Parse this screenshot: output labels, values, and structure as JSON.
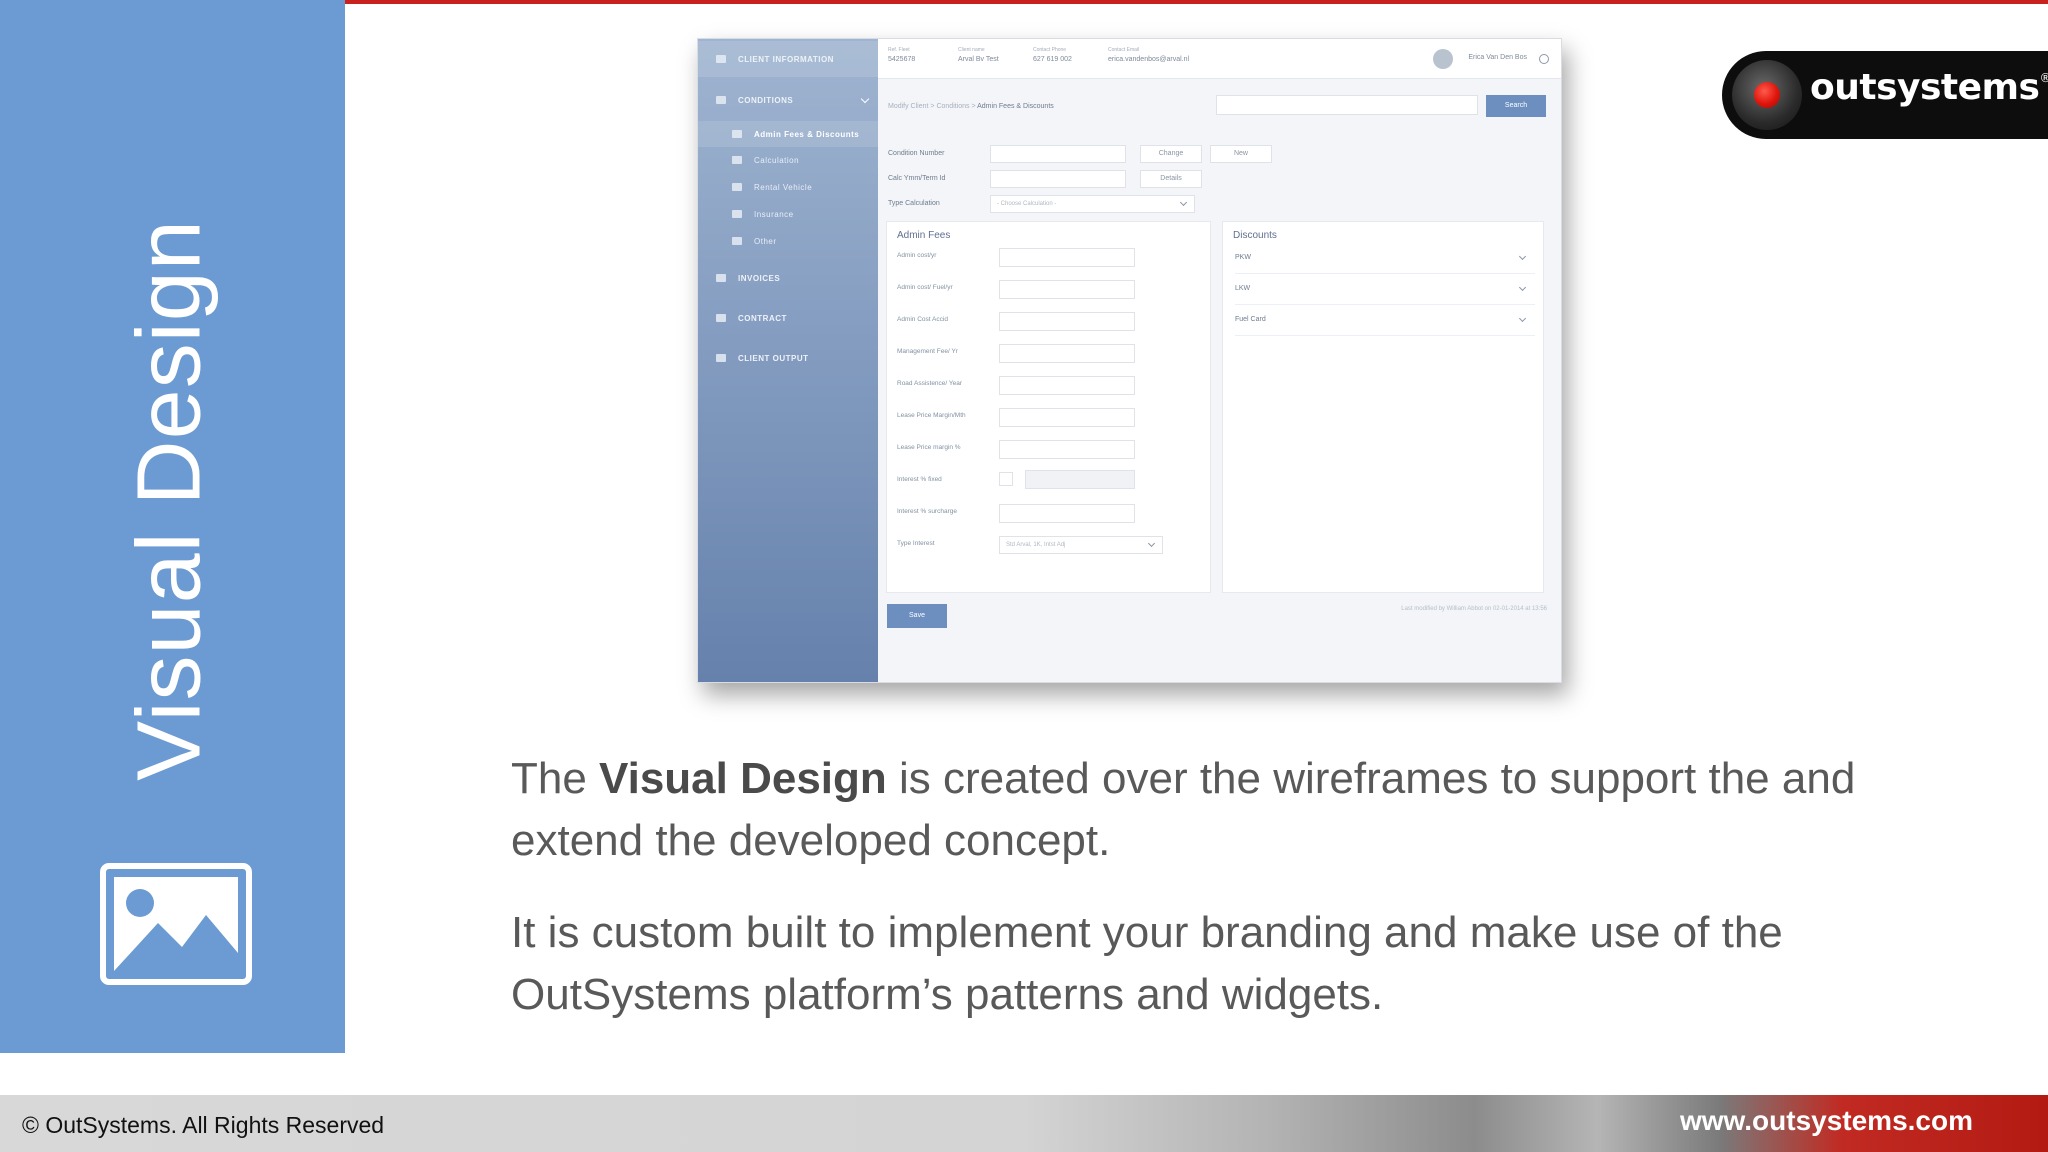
{
  "slide": {
    "vertical_title": "Visual Design",
    "paragraph1_pre": "The ",
    "paragraph1_bold": "Visual Design",
    "paragraph1_post": " is created over the wireframes to support the and extend the developed concept.",
    "paragraph2": "It is custom built to implement your branding and make use of the OutSystems platform’s patterns and widgets.",
    "icon": "picture-icon",
    "accent_color": "#c9211e",
    "panel_color": "#6b9bd2"
  },
  "logo": {
    "text": "outsystems",
    "mark": "®"
  },
  "footer": {
    "copyright": "© OutSystems. All Rights Reserved",
    "website": "www.outsystems.com"
  },
  "screenshot": {
    "sidebar": {
      "client_information": "CLIENT INFORMATION",
      "conditions": "CONDITIONS",
      "admin_fees": "Admin Fees & Discounts",
      "calculation": "Calculation",
      "rental_vehicle": "Rental Vehicle",
      "insurance": "Insurance",
      "other": "Other",
      "invoices": "INVOICES",
      "contract": "CONTRACT",
      "client_output": "CLIENT OUTPUT"
    },
    "topbar": {
      "f1_label": "Ref. Fleet",
      "f1_value": "5425678",
      "f2_label": "Client name",
      "f2_value": "Arval Bv Test",
      "f3_label": "Contact Phone",
      "f3_value": "627 619 002",
      "f4_label": "Contact Email",
      "f4_value": "erica.vandenbos@arval.nl",
      "user": "Erica Van Den Bos"
    },
    "breadcrumb": {
      "c1": "Modify Client",
      "c2": "Conditions",
      "c3": "Admin Fees & Discounts"
    },
    "search_label": "Search",
    "form": {
      "condition_number": "Condition Number",
      "change": "Change",
      "new": "New",
      "calc_term": "Calc Ymm/Term Id",
      "details": "Details",
      "type_calculation": "Type Calculation",
      "type_calculation_value": "- Choose Calculation -"
    },
    "admin_fees": {
      "title": "Admin Fees",
      "labels": [
        "Admin cost/yr",
        "Admin cost/ Fuel/yr",
        "Admin Cost Accid",
        "Management Fee/ Yr",
        "Road Assistence/ Year",
        "Lease Price Margin/Mth",
        "Lease Price margin %",
        "Interest % fixed",
        "Interest % surcharge",
        "Type Interest"
      ],
      "type_interest_value": "Std Arval, 1K, Intst Adj"
    },
    "discounts": {
      "title": "Discounts",
      "items": [
        "PKW",
        "LKW",
        "Fuel Card"
      ]
    },
    "save_label": "Save",
    "last_modified": "Last modified by William Abbot on 02-01-2014 at 13:56"
  }
}
